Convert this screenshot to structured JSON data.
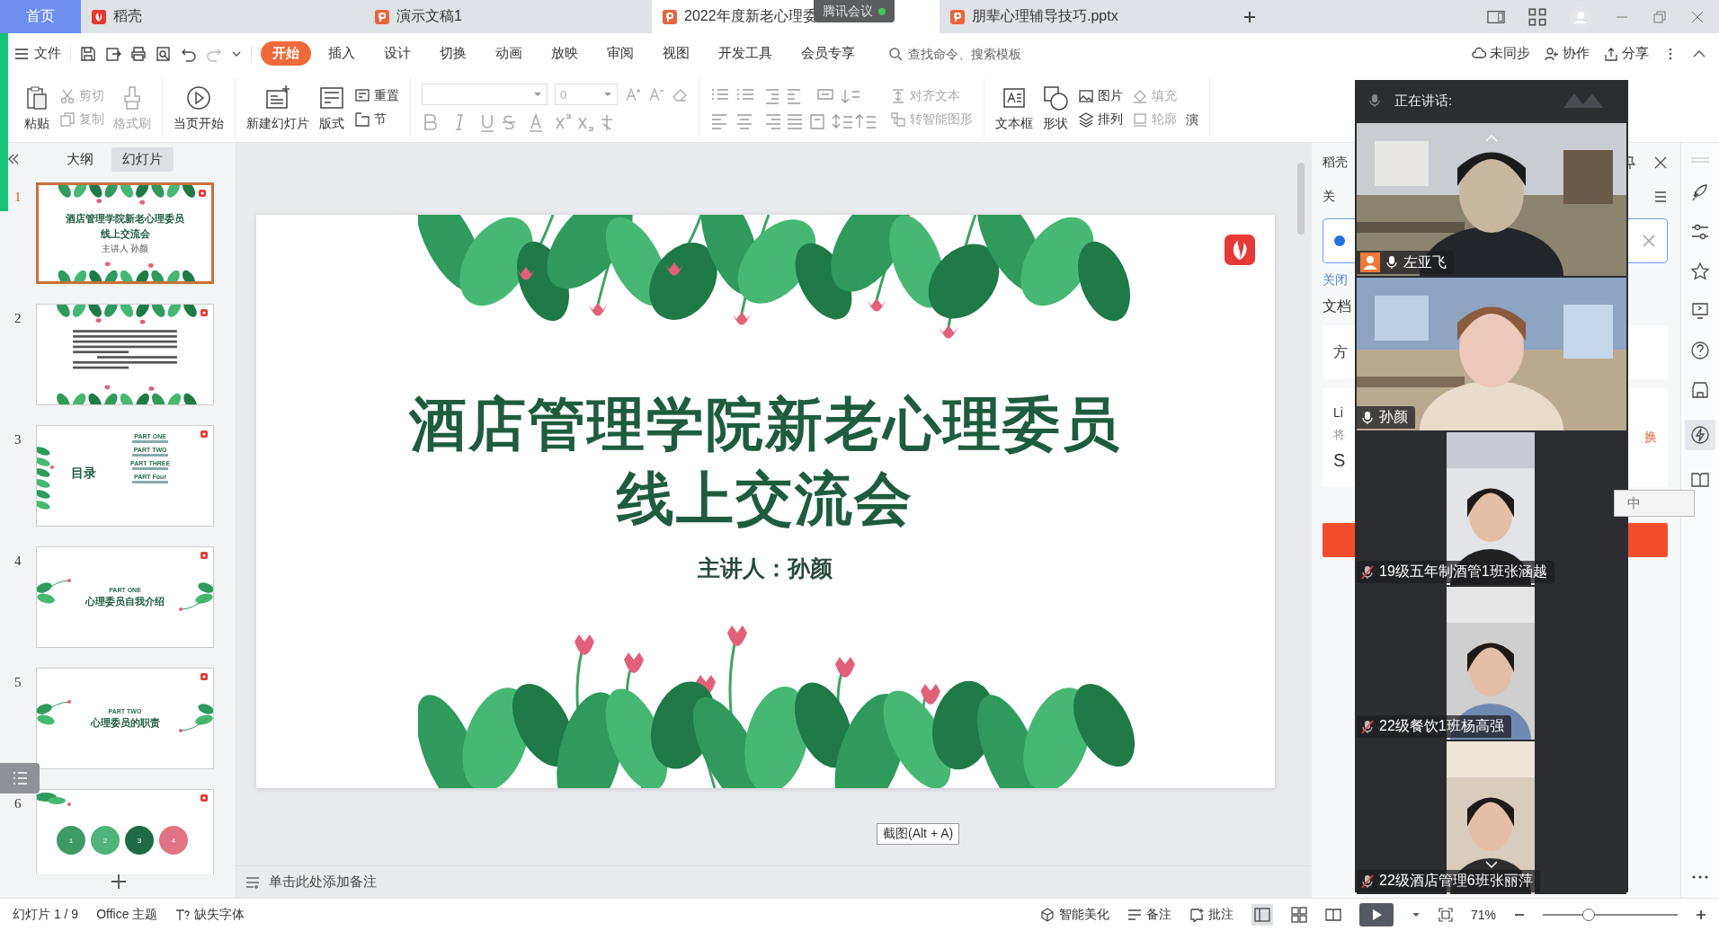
{
  "tabs": [
    {
      "label": "首页",
      "kind": "home",
      "selected": false
    },
    {
      "label": "稻壳",
      "kind": "docer",
      "selected": false
    },
    {
      "label": "演示文稿1",
      "kind": "ppt",
      "selected": false
    },
    {
      "label": "2022年度新老心理委",
      "kind": "ppt",
      "selected": true
    },
    {
      "label": "朋辈心理辅导技巧.pptx",
      "kind": "ppt",
      "selected": false
    }
  ],
  "meeting_pill": {
    "label": "腾讯会议"
  },
  "menu": {
    "file": "文件",
    "tabs": [
      {
        "label": "开始",
        "selected": true
      },
      {
        "label": "插入",
        "selected": false
      },
      {
        "label": "设计",
        "selected": false
      },
      {
        "label": "切换",
        "selected": false
      },
      {
        "label": "动画",
        "selected": false
      },
      {
        "label": "放映",
        "selected": false
      },
      {
        "label": "审阅",
        "selected": false
      },
      {
        "label": "视图",
        "selected": false
      },
      {
        "label": "开发工具",
        "selected": false
      },
      {
        "label": "会员专享",
        "selected": false
      }
    ],
    "search": {
      "placeholder": "查找命令、搜索模板"
    },
    "actions": [
      "未同步",
      "协作",
      "分享"
    ]
  },
  "ribbon": {
    "paste": "粘贴",
    "clipboard": [
      {
        "label": "剪切",
        "disabled": true
      },
      {
        "label": "复制",
        "disabled": true
      },
      {
        "label": "格式刷",
        "disabled": true
      }
    ],
    "play": "当页开始",
    "new_slide": "新建幻灯片",
    "layout": "版式",
    "reset": "重置",
    "section": "节",
    "font_size": "0",
    "align_text": {
      "label": "对齐文本",
      "disabled": true
    },
    "smart_art": {
      "label": "转智能图形",
      "disabled": true
    },
    "textbox": "文本框",
    "shape": "形状",
    "picture": "图片",
    "arrange": "排列",
    "fill": {
      "label": "填充",
      "disabled": true
    },
    "outline": {
      "label": "轮廓",
      "disabled": true
    },
    "cut_off": "演"
  },
  "panel": {
    "tabs": [
      {
        "label": "大纲",
        "selected": false
      },
      {
        "label": "幻灯片",
        "selected": true
      }
    ],
    "slides": [
      {
        "number": "1",
        "selected": true,
        "kind": "title",
        "title": "酒店管理学院新老心理委员",
        "subtitle": "线上交流会",
        "speaker": "主讲人  孙颜"
      },
      {
        "number": "2",
        "selected": false,
        "kind": "text"
      },
      {
        "number": "3",
        "selected": false,
        "kind": "contents",
        "title": "目录",
        "items": [
          "PART ONE",
          "PART TWO",
          "PART THREE",
          "PART Four"
        ]
      },
      {
        "number": "4",
        "selected": false,
        "kind": "section",
        "overline": "PART ONE",
        "title": "心理委员自我介绍"
      },
      {
        "number": "5",
        "selected": false,
        "kind": "section",
        "overline": "PART TWO",
        "title": "心理委员的职责"
      },
      {
        "number": "6",
        "selected": false,
        "kind": "circles",
        "items": [
          "1",
          "2",
          "3",
          "4"
        ]
      }
    ]
  },
  "slide": {
    "title_lines": [
      "酒店管理学院新老心理委员",
      "线上交流会"
    ],
    "speaker": "主讲人：孙颜"
  },
  "tooltip": "截图(Alt + A)",
  "notes_placeholder": "单击此处添加备注",
  "side_panel": {
    "title": "稻壳",
    "tab_fragment": "关",
    "close_link": "关闭",
    "section": "文档",
    "card_fragment": "方",
    "list_fragments": [
      "Li",
      "将",
      "S"
    ],
    "link_fragment": "换"
  },
  "ime": {
    "label": "中"
  },
  "video": {
    "header": "正在讲话:",
    "tiles": [
      {
        "name": "左亚飞",
        "muted": false,
        "host": true,
        "kind": "wide"
      },
      {
        "name": "孙颜",
        "muted": false,
        "host": false,
        "kind": "wide"
      },
      {
        "name": "19级五年制酒管1班张涵越",
        "muted": true,
        "host": false,
        "kind": "narrow"
      },
      {
        "name": "22级餐饮1班杨高强",
        "muted": true,
        "host": false,
        "kind": "narrow"
      },
      {
        "name": "22级酒店管理6班张丽萍",
        "muted": true,
        "host": false,
        "kind": "narrow"
      }
    ]
  },
  "status": {
    "slide": "幻灯片 1 / 9",
    "theme": "Office 主题",
    "missing_font": "缺失字体",
    "beautify": "智能美化",
    "notes": "备注",
    "comments": "批注",
    "zoom": "71%",
    "zoom_slider": {
      "level": 0.34
    }
  }
}
